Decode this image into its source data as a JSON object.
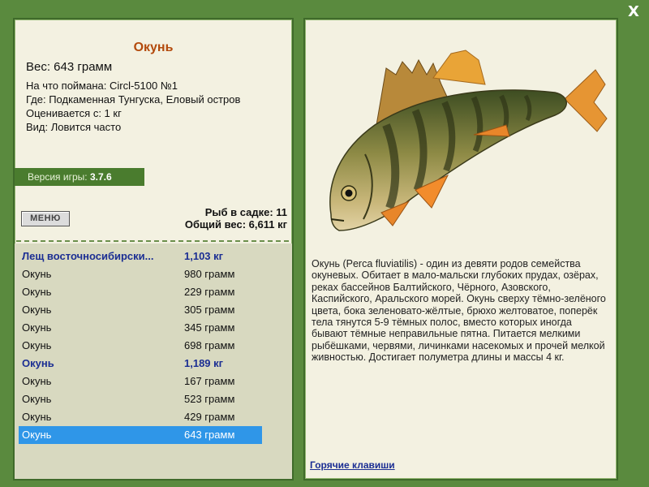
{
  "close": "X",
  "catch": {
    "title": "Окунь",
    "weight": "Вес: 643 грамм",
    "bait": "На что поймана: Circl-5100 №1",
    "place": "Где: Подкаменная Тунгуска, Еловый остров",
    "rated": "Оценивается с: 1 кг",
    "kind": "Вид: Ловится часто"
  },
  "version": {
    "label": "Версия игры:",
    "value": "3.7.6"
  },
  "menu_label": "МЕНЮ",
  "net": {
    "count": "Рыб в садке: 11",
    "total": "Общий вес: 6,611 кг"
  },
  "list": [
    {
      "name": "Лещ восточносибирски...",
      "weight": "1,103 кг"
    },
    {
      "name": "Окунь",
      "weight": "980 грамм"
    },
    {
      "name": "Окунь",
      "weight": "229 грамм"
    },
    {
      "name": "Окунь",
      "weight": "305 грамм"
    },
    {
      "name": "Окунь",
      "weight": "345 грамм"
    },
    {
      "name": "Окунь",
      "weight": "698 грамм"
    },
    {
      "name": "Окунь",
      "weight": "1,189 кг"
    },
    {
      "name": "Окунь",
      "weight": "167 грамм"
    },
    {
      "name": "Окунь",
      "weight": "523 грамм"
    },
    {
      "name": "Окунь",
      "weight": "429 грамм"
    },
    {
      "name": "Окунь",
      "weight": "643 грамм"
    }
  ],
  "description": "Окунь (Perca fluviatilis) - один из девяти родов семейства окуневых. Обитает в мало-мальски глубоких прудах, озёрах, реках бассейнов Балтийского, Чёрного, Азовского, Каспийского, Аральского морей. Окунь сверху тёмно-зелёного цвета, бока зеленовато-жёлтые, брюхо желтоватое, поперёк тела тянутся 5-9 тёмных полос, вместо которых иногда бывают тёмные неправильные пятна. Питается мелкими рыбёшками, червями, личинками насекомых и прочей мелкой живностью. Достигает полуметра длины и массы 4 кг.",
  "hotkeys": "Горячие клавиши",
  "colors": {
    "frame": "#5a8a3e",
    "panel": "#f3f1e1",
    "title": "#b34a0c",
    "trophy": "#1b2e93",
    "selected": "#2f96e8"
  }
}
